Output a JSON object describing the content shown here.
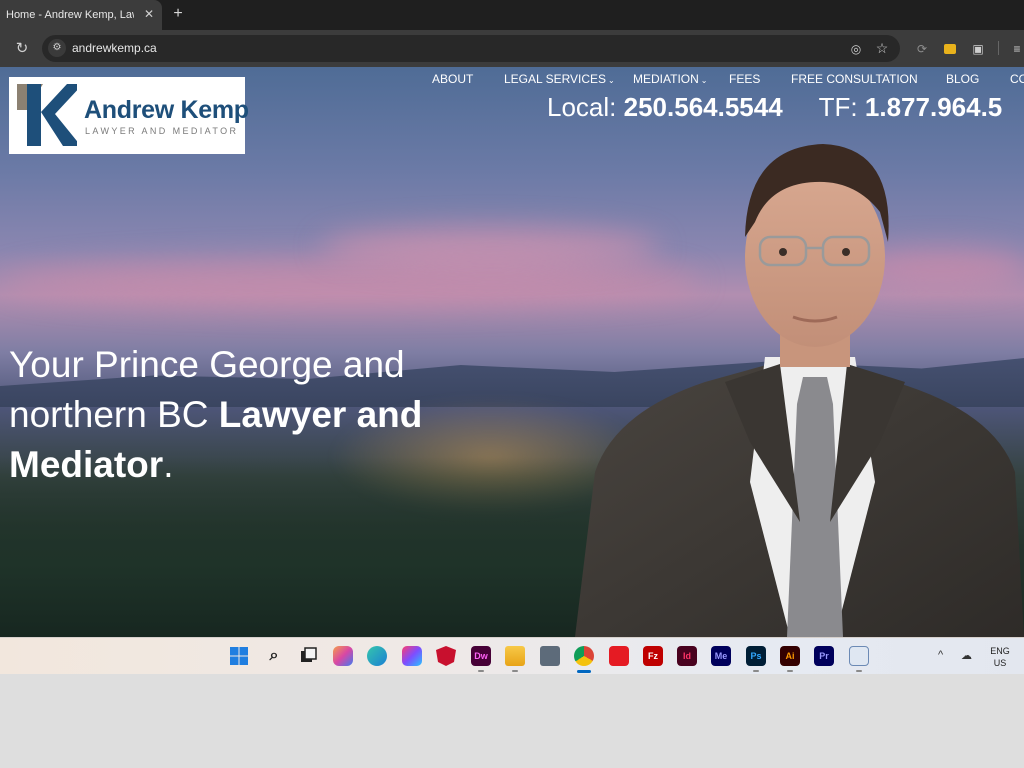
{
  "browser": {
    "tab_title": "Home - Andrew Kemp, Lawyer a",
    "url": "andrewkemp.ca"
  },
  "site": {
    "logo": {
      "name": "Andrew Kemp",
      "tagline": "LAWYER AND MEDIATOR",
      "brand_blue": "#1e4f7a",
      "brand_gray": "#8c8172"
    },
    "nav": [
      {
        "label": "ABOUT"
      },
      {
        "label": "LEGAL SERVICES"
      },
      {
        "label": "MEDIATION"
      },
      {
        "label": "FEES"
      },
      {
        "label": "FREE CONSULTATION"
      },
      {
        "label": "BLOG"
      },
      {
        "label": "CO"
      }
    ],
    "phones": {
      "local_label": "Local:",
      "local_number": "250.564.5544",
      "tf_label": "TF:",
      "tf_number": "1.877.964.5"
    },
    "hero": {
      "line1": "Your Prince George and",
      "line2_plain": "northern BC",
      "line2_bold": "Lawyer and",
      "line3_bold": "Mediator",
      "line3_end": "."
    }
  },
  "taskbar": {
    "apps": [
      {
        "name": "Start",
        "icon": "windows-icon"
      },
      {
        "name": "Search",
        "icon": "search-icon"
      },
      {
        "name": "Task View",
        "icon": "task-view-icon"
      },
      {
        "name": "Copilot",
        "icon": "copilot-icon"
      },
      {
        "name": "Edge",
        "icon": "edge-icon"
      },
      {
        "name": "Creative Cloud",
        "icon": "creative-cloud-icon"
      },
      {
        "name": "McAfee",
        "icon": "mcafee-icon"
      },
      {
        "name": "Dreamweaver",
        "icon": "dreamweaver-icon",
        "label": "Dw"
      },
      {
        "name": "File Explorer",
        "icon": "folder-icon"
      },
      {
        "name": "Calculator",
        "icon": "calculator-icon"
      },
      {
        "name": "Chrome",
        "icon": "chrome-icon"
      },
      {
        "name": "Acrobat",
        "icon": "acrobat-icon"
      },
      {
        "name": "FileZilla",
        "icon": "filezilla-icon"
      },
      {
        "name": "InDesign",
        "icon": "indesign-icon",
        "label": "Id"
      },
      {
        "name": "Media Encoder",
        "icon": "media-encoder-icon",
        "label": "Me"
      },
      {
        "name": "Photoshop",
        "icon": "photoshop-icon",
        "label": "Ps"
      },
      {
        "name": "Illustrator",
        "icon": "illustrator-icon",
        "label": "Ai"
      },
      {
        "name": "Premiere",
        "icon": "premiere-icon",
        "label": "Pr"
      },
      {
        "name": "Notepad",
        "icon": "notepad-icon"
      }
    ],
    "language_line1": "ENG",
    "language_line2": "US"
  }
}
